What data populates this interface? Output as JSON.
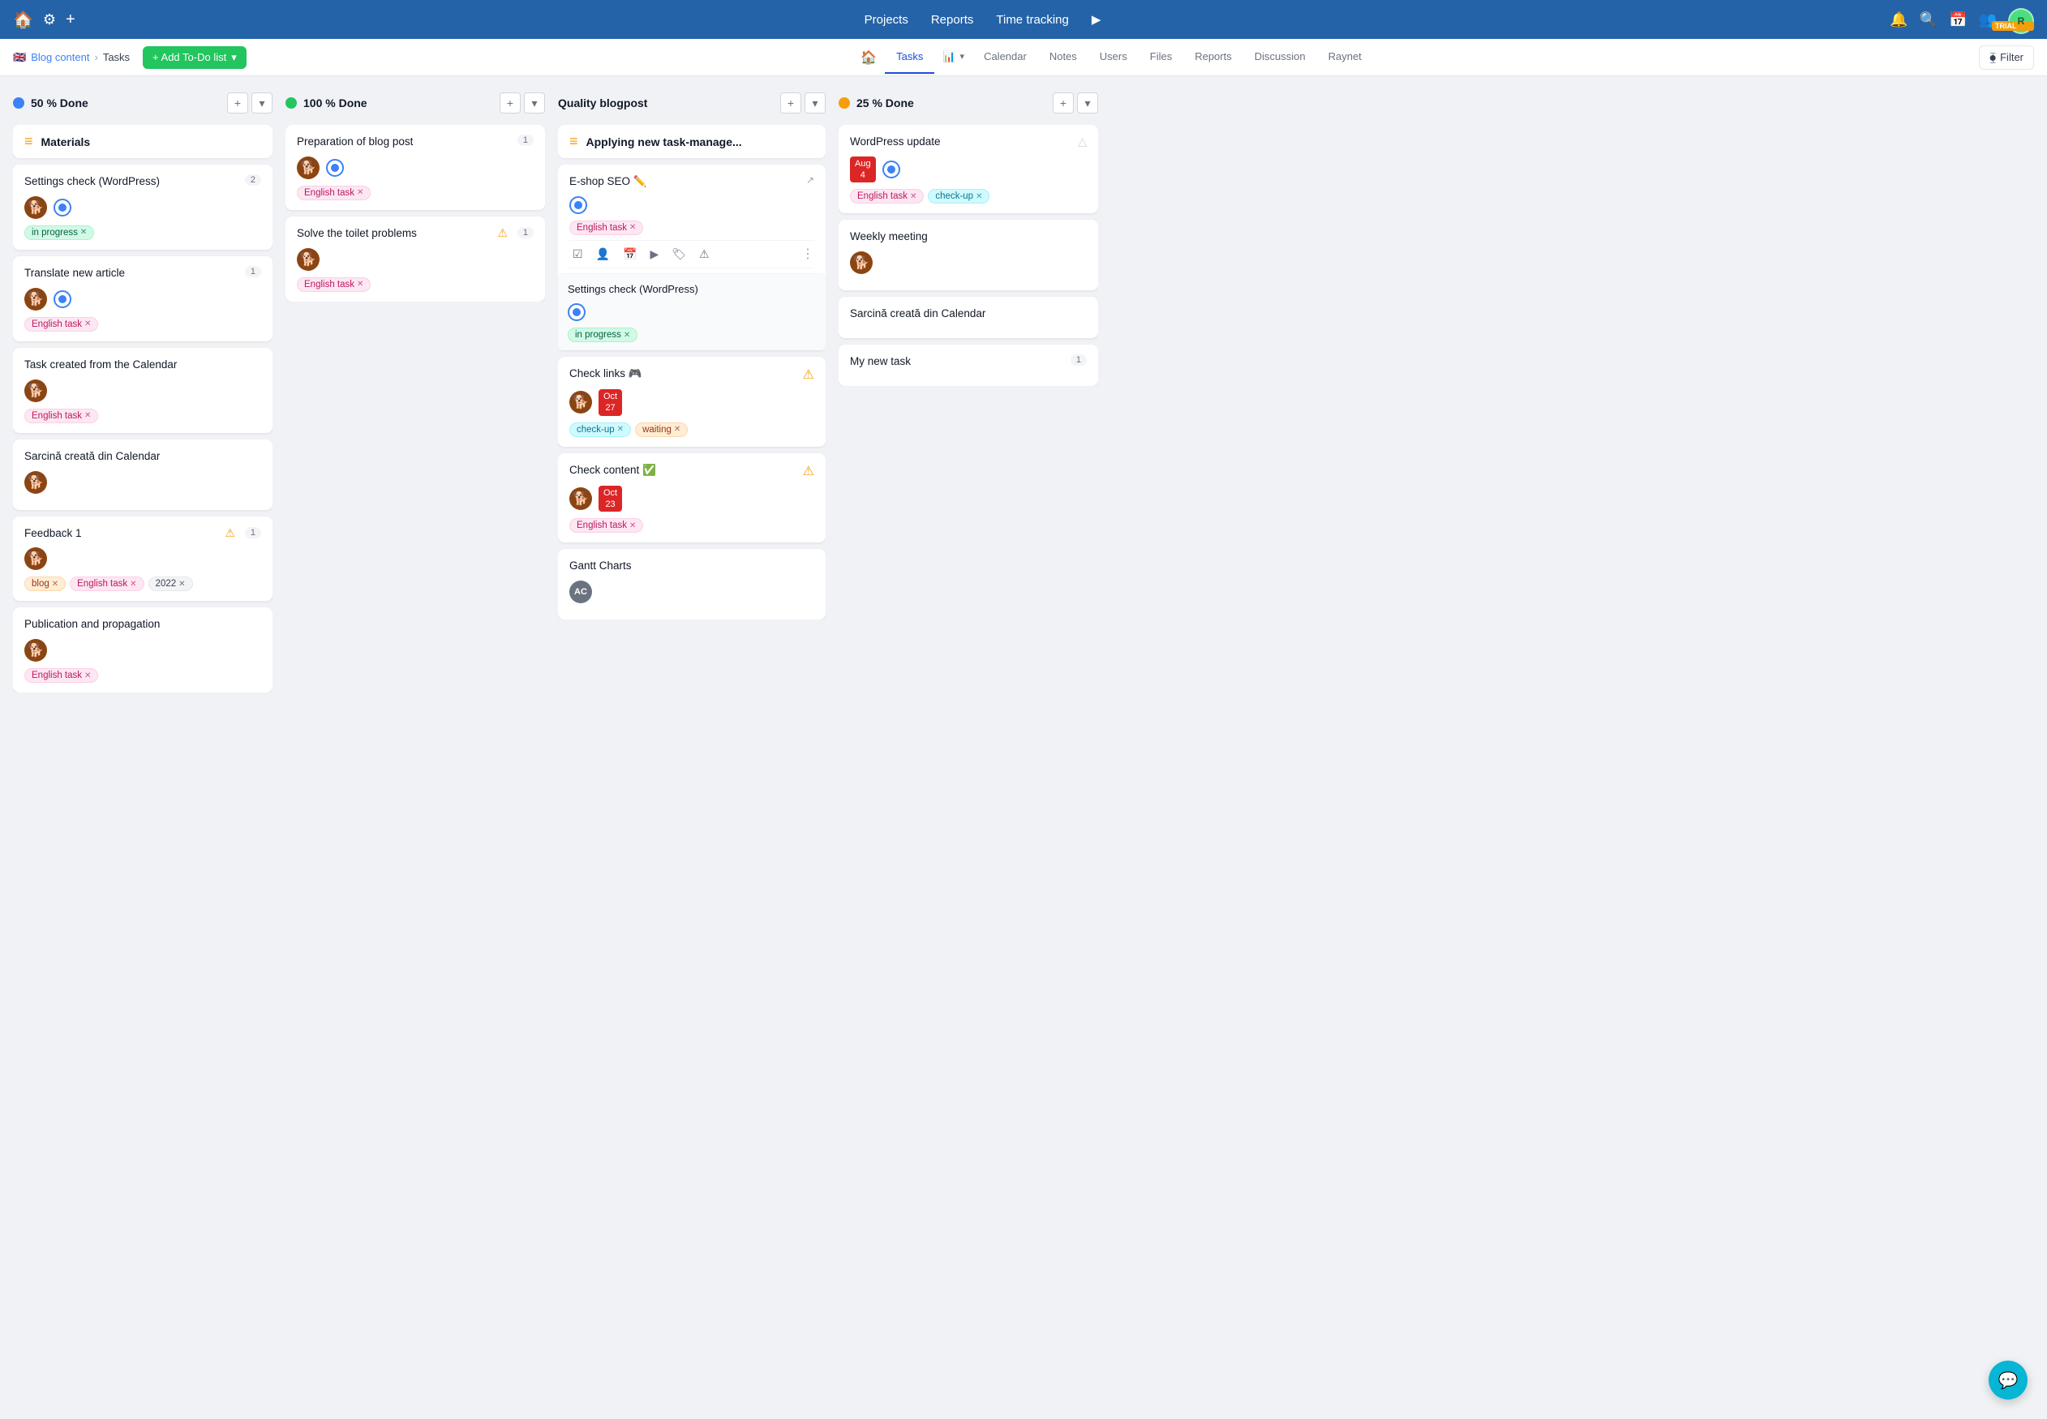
{
  "topNav": {
    "homeIcon": "🏠",
    "settingsIcon": "⚙",
    "addIcon": "+",
    "navItems": [
      "Projects",
      "Reports",
      "Time tracking"
    ],
    "playIcon": "▶",
    "bellIcon": "🔔",
    "searchIcon": "🔍",
    "calendarIcon": "📅",
    "usersIcon": "👥",
    "avatarText": "R",
    "trialLabel": "TRIAL"
  },
  "subNav": {
    "flag": "🇬🇧",
    "projectName": "Blog content",
    "separator": ">",
    "tasksLabel": "Tasks",
    "addBtnLabel": "+ Add To-Do list",
    "homeIcon": "🏠",
    "tabs": [
      {
        "label": "Tasks",
        "icon": "",
        "active": true
      },
      {
        "label": "📊",
        "active": false
      },
      {
        "label": "Calendar",
        "active": false
      },
      {
        "label": "Notes",
        "active": false
      },
      {
        "label": "Users",
        "active": false
      },
      {
        "label": "Files",
        "active": false
      },
      {
        "label": "Reports",
        "active": false
      },
      {
        "label": "Discussion",
        "active": false
      },
      {
        "label": "Raynet",
        "active": false
      }
    ],
    "filterLabel": "Filter"
  },
  "columns": [
    {
      "id": "col1",
      "dotColor": "blue",
      "title": "50 % Done",
      "cards": [
        {
          "id": "c1",
          "type": "section",
          "sectionIcon": "≡",
          "title": "Materials"
        },
        {
          "id": "c2",
          "title": "Settings check (WordPress)",
          "count": "2",
          "avatars": [
            "dog"
          ],
          "statusCircle": true,
          "tags": [
            {
              "label": "in progress",
              "style": "green",
              "x": true
            }
          ]
        },
        {
          "id": "c3",
          "title": "Translate new article",
          "count": "1",
          "avatars": [
            "dog2",
            "blue-dot"
          ],
          "tags": [
            {
              "label": "English task",
              "style": "pink",
              "x": true
            }
          ]
        },
        {
          "id": "c4",
          "title": "Task created from the Calendar",
          "avatars": [
            "dog"
          ],
          "tags": [
            {
              "label": "English task",
              "style": "pink",
              "x": true
            }
          ]
        },
        {
          "id": "c5",
          "title": "Sarcină creată din Calendar",
          "avatars": [
            "dog"
          ]
        },
        {
          "id": "c6",
          "title": "Feedback 1",
          "warning": true,
          "count": "1",
          "avatars": [
            "dog"
          ],
          "tags": [
            {
              "label": "blog",
              "style": "orange",
              "x": true
            },
            {
              "label": "English task",
              "style": "pink",
              "x": true
            },
            {
              "label": "2022",
              "style": "gray",
              "x": true
            }
          ]
        },
        {
          "id": "c7",
          "title": "Publication and propagation",
          "avatars": [
            "dog"
          ],
          "tags": [
            {
              "label": "English task",
              "style": "pink",
              "x": true
            }
          ]
        }
      ]
    },
    {
      "id": "col2",
      "dotColor": "green",
      "title": "100 % Done",
      "cards": [
        {
          "id": "c8",
          "title": "Preparation of blog post",
          "count": "1",
          "avatars": [
            "dog"
          ],
          "statusCircle": true,
          "tags": [
            {
              "label": "English task",
              "style": "pink",
              "x": true
            }
          ]
        },
        {
          "id": "c9",
          "title": "Solve the toilet problems",
          "warning": true,
          "count": "1",
          "avatars": [
            "dog"
          ],
          "tags": [
            {
              "label": "English task",
              "style": "pink",
              "x": true
            }
          ]
        }
      ]
    },
    {
      "id": "col3",
      "title": "Quality blogpost",
      "cards": [
        {
          "id": "c10",
          "type": "section",
          "sectionIcon": "≡",
          "title": "Applying new task-manage..."
        },
        {
          "id": "c11",
          "title": "E-shop SEO ✏️",
          "extLink": true,
          "statusCircle": true,
          "tags": [
            {
              "label": "English task",
              "style": "pink",
              "x": true
            }
          ],
          "hasToolbar": true,
          "toolbarIcons": [
            "☑",
            "👤",
            "📅",
            "▶",
            "🏷",
            "⚠"
          ],
          "moreBtn": true,
          "subCard": {
            "title": "Settings check (WordPress)",
            "statusCircle": true,
            "tag": {
              "label": "in progress",
              "style": "green",
              "x": true
            }
          }
        },
        {
          "id": "c12",
          "title": "Check links 🎮",
          "warning": true,
          "avatars": [
            "dog"
          ],
          "dateBadge": {
            "month": "Oct",
            "day": "27"
          },
          "tags": [
            {
              "label": "check-up",
              "style": "cyan",
              "x": true
            },
            {
              "label": "waiting",
              "style": "orange",
              "x": true
            }
          ]
        },
        {
          "id": "c13",
          "title": "Check content ✅",
          "warning": true,
          "avatars": [
            "dog"
          ],
          "dateBadge": {
            "month": "Oct",
            "day": "23"
          },
          "tags": [
            {
              "label": "English task",
              "style": "pink",
              "x": true
            }
          ]
        },
        {
          "id": "c14",
          "title": "Gantt Charts",
          "avatars": [
            "ac"
          ]
        }
      ]
    },
    {
      "id": "col4",
      "dotColor": "yellow",
      "title": "25 % Done",
      "cards": [
        {
          "id": "c15",
          "title": "WordPress update",
          "warningOutline": true,
          "dateBadgeTop": {
            "month": "Aug",
            "day": "4"
          },
          "statusCircle": true,
          "tags": [
            {
              "label": "English task",
              "style": "pink",
              "x": true
            },
            {
              "label": "check-up",
              "style": "cyan",
              "x": true
            }
          ]
        },
        {
          "id": "c16",
          "title": "Weekly meeting",
          "avatars": [
            "dog"
          ]
        },
        {
          "id": "c17",
          "title": "Sarcină creată din Calendar"
        },
        {
          "id": "c18",
          "title": "My new task",
          "count": "1"
        }
      ]
    }
  ],
  "chatFab": "💬"
}
